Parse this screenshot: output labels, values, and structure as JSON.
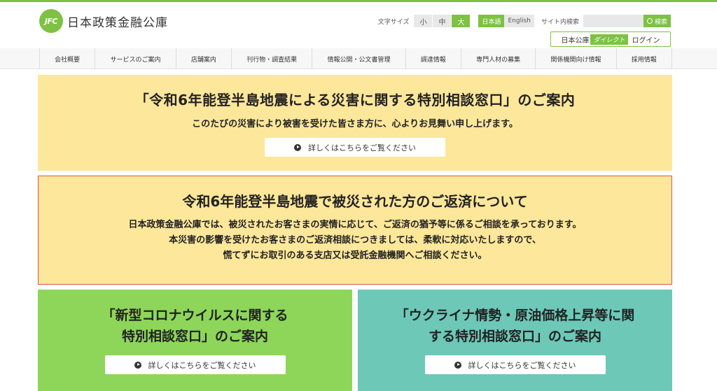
{
  "header": {
    "logo_mark": "JFC",
    "logo_text": "日本政策金融公庫",
    "font_size_label": "文字サイズ",
    "font_sizes": [
      "小",
      "中",
      "大"
    ],
    "languages": [
      "日本語",
      "English"
    ],
    "search_label": "サイト内検索",
    "search_placeholder": "",
    "search_button": "検索",
    "direct_prefix": "日本公庫",
    "direct_tag": "ダイレクト",
    "direct_login": "ログイン"
  },
  "nav": {
    "items": [
      "会社概要",
      "サービスのご案内",
      "店舗案内",
      "刊行物・調査結果",
      "情報公開・公文書管理",
      "調達情報",
      "専門人材の募集",
      "関係機関向け情報",
      "採用情報"
    ]
  },
  "banner1": {
    "title": "「令和6年能登半島地震による災害に関する特別相談窓口」のご案内",
    "subtitle": "このたびの災害により被害を受けた皆さま方に、心よりお見舞い申し上げます。",
    "button": "詳しくはこちらをご覧ください"
  },
  "banner2": {
    "title": "令和6年能登半島地震で被災された方のご返済について",
    "lines": [
      "日本政策金融公庫では、被災されたお客さまの実情に応じて、ご返済の猶予等に係るご相談を承っております。",
      "本災害の影響を受けたお客さまのご返済相談につきましては、柔軟に対応いたしますので、",
      "慌てずにお取引のある支店又は受託金融機関へご相談ください。"
    ]
  },
  "card_corona": {
    "title_line1": "「新型コロナウイルスに関する",
    "title_line2": "特別相談窓口」のご案内",
    "button": "詳しくはこちらをご覧ください"
  },
  "card_ukraine": {
    "title_line1": "「ウクライナ情勢・原油価格上昇等に関",
    "title_line2": "する特別相談窓口」のご案内",
    "button": "詳しくはこちらをご覧ください"
  },
  "colors": {
    "brand_green": "#7dc242",
    "banner_yellow": "#fde79a",
    "alert_red": "#e05050",
    "card_green": "#8dd65a",
    "card_teal": "#6dc8b8"
  }
}
